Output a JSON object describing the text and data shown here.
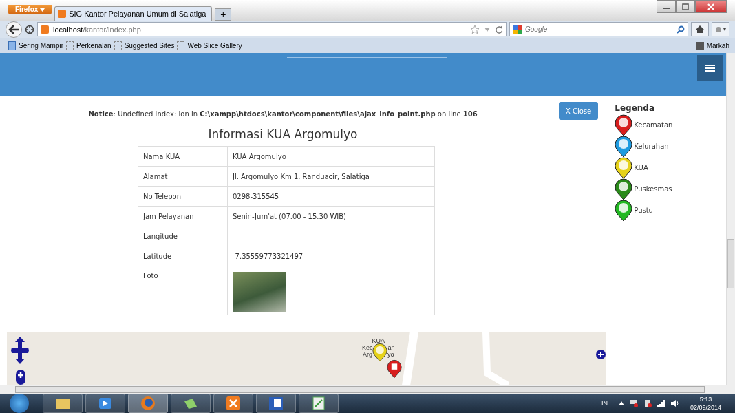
{
  "browser": {
    "menu_button": "Firefox",
    "tabs": [
      {
        "title": "SIG Kantor Pelayanan Umum di Salatiga",
        "selected": true
      }
    ],
    "new_tab": "+",
    "url_host": "localhost",
    "url_path": "/kantor/index.php",
    "search_placeholder": "Google",
    "bookmarks": [
      "Sering Mampir",
      "Perkenalan",
      "Suggested Sites",
      "Web Slice Gallery"
    ],
    "bookmarks_right": "Markah"
  },
  "notice": "**Notice**: Undefined index: lon in **C:\\xampp\\htdocs\\kantor\\component\\files\\ajax_info_point.php** on line **106**",
  "close_button": "X Close",
  "info": {
    "title": "Informasi KUA Argomulyo",
    "rows": [
      {
        "label": "Nama KUA",
        "value": "KUA Argomulyo"
      },
      {
        "label": "Alamat",
        "value": "Jl. Argomulyo Km 1, Randuacir, Salatiga"
      },
      {
        "label": "No Telepon",
        "value": "0298-315545"
      },
      {
        "label": "Jam Pelayanan",
        "value": "Senin-Jum'at (07.00 - 15.30 WIB)"
      },
      {
        "label": "Langitude",
        "value": ""
      },
      {
        "label": "Latitude",
        "value": "-7.35559773321497"
      },
      {
        "label": "Foto",
        "kind": "photo"
      }
    ]
  },
  "legend": {
    "title": "Legenda",
    "items": [
      {
        "label": "Kecamatan",
        "color": "#d81e1e"
      },
      {
        "label": "Kelurahan",
        "color": "#1e9be0"
      },
      {
        "label": "KUA",
        "color": "#e6d21a"
      },
      {
        "label": "Puskesmas",
        "color": "#2a8a1a"
      },
      {
        "label": "Pustu",
        "color": "#22b822"
      }
    ]
  },
  "map": {
    "label_lines": [
      "KUA",
      "Kec",
      "an",
      "Arg",
      "yo"
    ]
  },
  "taskbar": {
    "language": "IN",
    "time": "5:13",
    "date": "02/09/2014"
  }
}
